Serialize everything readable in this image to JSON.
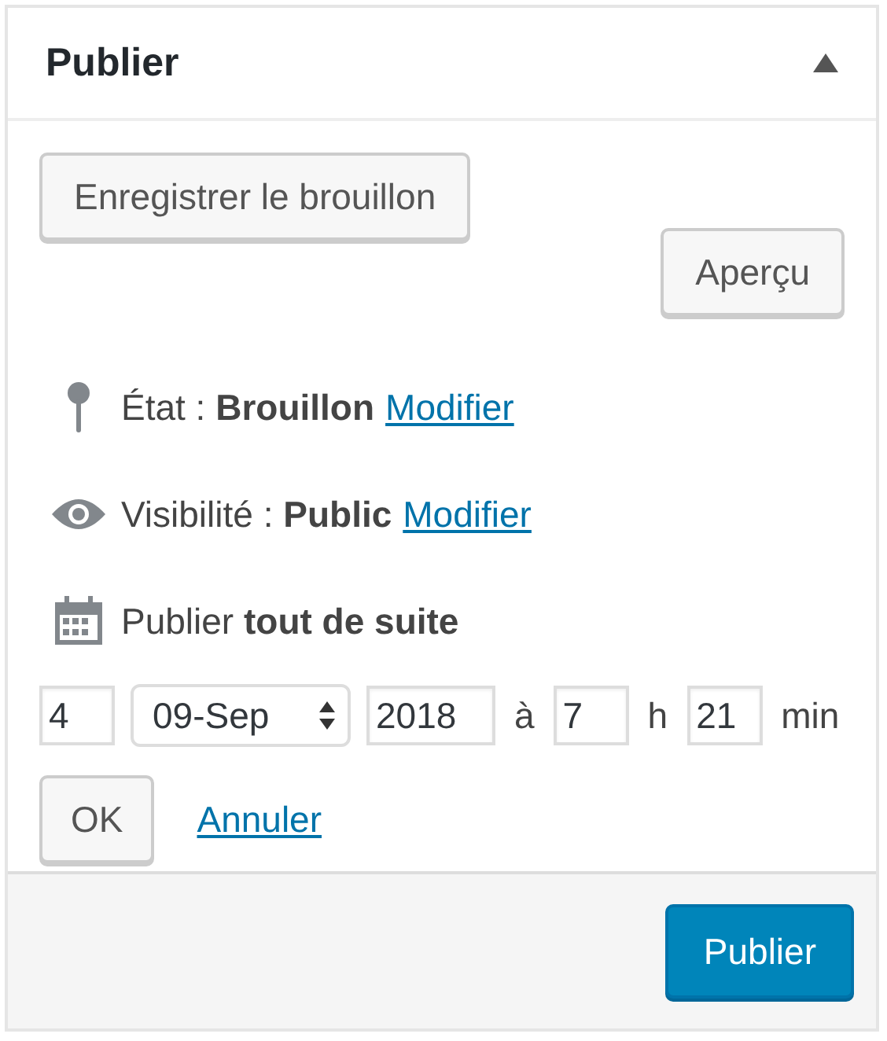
{
  "header": {
    "title": "Publier"
  },
  "buttons": {
    "save_draft": "Enregistrer le brouillon",
    "preview": "Aperçu"
  },
  "misc": [
    {
      "kind": "status",
      "label": "État :",
      "value": "Brouillon",
      "link": "Modifier"
    },
    {
      "kind": "visibility",
      "label": "Visibilité :",
      "value": "Public",
      "link": "Modifier"
    },
    {
      "kind": "schedule",
      "label": "Publier",
      "value": "tout de suite"
    }
  ],
  "date": {
    "day": "4",
    "month": "09-Sep",
    "year": "2018",
    "at": "à",
    "hour": "7",
    "h": "h",
    "minute": "21",
    "min": "min"
  },
  "date_actions": {
    "ok": "OK",
    "cancel": "Annuler"
  },
  "footer": {
    "publish": "Publier"
  }
}
